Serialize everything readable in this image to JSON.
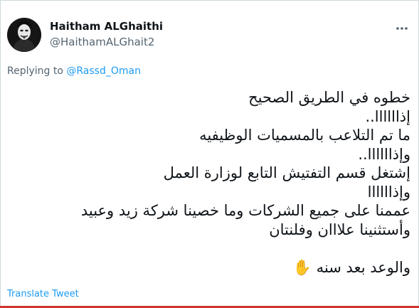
{
  "author": {
    "display_name": "Haitham ALGhaithi",
    "handle": "@HaithamALGhait2",
    "avatar_icon": "masked-figure-avatar"
  },
  "more_icon": "more-horizontal-icon",
  "reply": {
    "prefix": "Replying to",
    "mention": "@Rassd_Oman"
  },
  "tweet": {
    "lines": [
      "خطوه في الطريق الصحيح",
      "إذاااااا..",
      "ما تم التلاعب بالمسميات الوظيفيه",
      "وإذاااااا..",
      "إشتغل قسم التفتيش التابع لوزارة العمل",
      "وإذاااااا",
      "عممنا على جميع الشركات وما خصينا شركة زيد وعبيد",
      "وأستثنينا علااان وفلنتان",
      "",
      "والوعد بعد سنه ✋"
    ]
  },
  "translate_label": "Translate Tweet",
  "colors": {
    "link": "#1d9bf0",
    "text": "#0f1419",
    "secondary": "#536471",
    "border": "#cfd9de"
  }
}
